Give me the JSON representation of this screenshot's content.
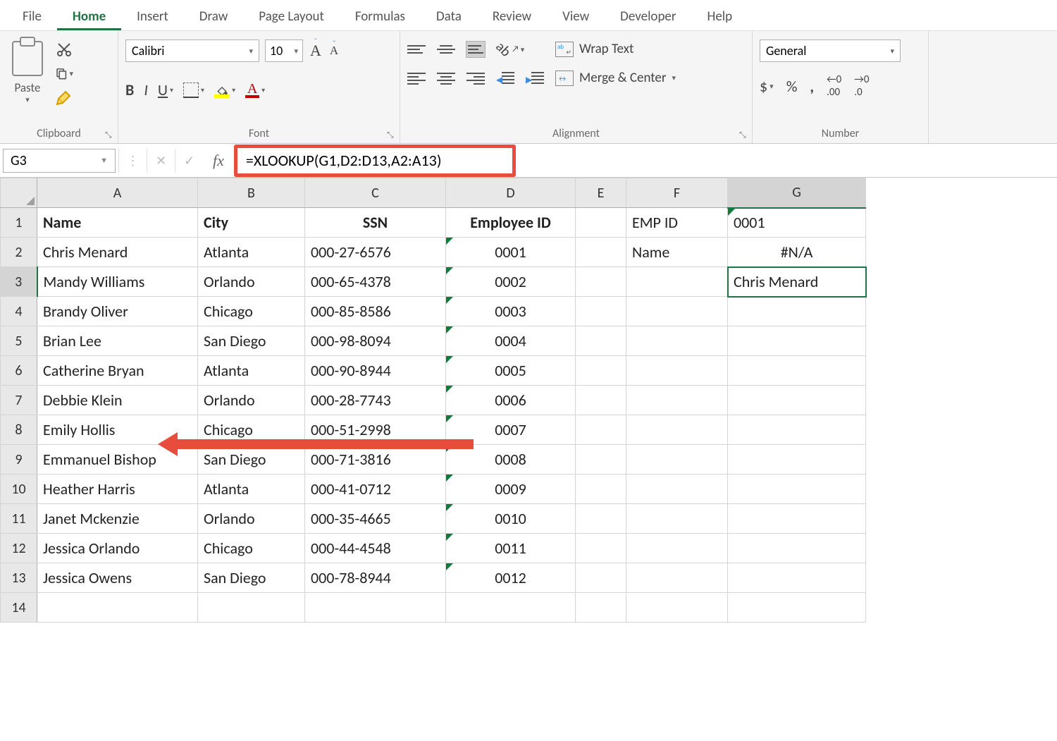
{
  "tabs": [
    "File",
    "Home",
    "Insert",
    "Draw",
    "Page Layout",
    "Formulas",
    "Data",
    "Review",
    "View",
    "Developer",
    "Help"
  ],
  "active_tab": "Home",
  "ribbon": {
    "clipboard": {
      "paste": "Paste",
      "label": "Clipboard"
    },
    "font": {
      "name": "Calibri",
      "size": "10",
      "label": "Font"
    },
    "alignment": {
      "wrap": "Wrap Text",
      "merge": "Merge & Center",
      "label": "Alignment"
    },
    "number": {
      "format": "General",
      "label": "Number"
    }
  },
  "formula_bar": {
    "name_box": "G3",
    "fx": "fx",
    "formula": "=XLOOKUP(G1,D2:D13,A2:A13)"
  },
  "columns": [
    "A",
    "B",
    "C",
    "D",
    "E",
    "F",
    "G"
  ],
  "row_numbers": [
    "1",
    "2",
    "3",
    "4",
    "5",
    "6",
    "7",
    "8",
    "9",
    "10",
    "11",
    "12",
    "13",
    "14"
  ],
  "headers": {
    "A": "Name",
    "B": "City",
    "C": "SSN",
    "D": "Employee ID"
  },
  "lookup": {
    "F1": "EMP ID",
    "G1": "0001",
    "F2": "Name",
    "G2": "#N/A",
    "G3": "Chris Menard"
  },
  "rows": [
    {
      "name": "Chris Menard",
      "city": "Atlanta",
      "ssn": "000-27-6576",
      "id": "0001"
    },
    {
      "name": "Mandy Williams",
      "city": "Orlando",
      "ssn": "000-65-4378",
      "id": "0002"
    },
    {
      "name": "Brandy Oliver",
      "city": "Chicago",
      "ssn": "000-85-8586",
      "id": "0003"
    },
    {
      "name": "Brian Lee",
      "city": "San Diego",
      "ssn": "000-98-8094",
      "id": "0004"
    },
    {
      "name": "Catherine Bryan",
      "city": "Atlanta",
      "ssn": "000-90-8944",
      "id": "0005"
    },
    {
      "name": "Debbie Klein",
      "city": "Orlando",
      "ssn": "000-28-7743",
      "id": "0006"
    },
    {
      "name": "Emily Hollis",
      "city": "Chicago",
      "ssn": "000-51-2998",
      "id": "0007"
    },
    {
      "name": "Emmanuel Bishop",
      "city": "San Diego",
      "ssn": "000-71-3816",
      "id": "0008"
    },
    {
      "name": "Heather Harris",
      "city": "Atlanta",
      "ssn": "000-41-0712",
      "id": "0009"
    },
    {
      "name": "Janet Mckenzie",
      "city": "Orlando",
      "ssn": "000-35-4665",
      "id": "0010"
    },
    {
      "name": "Jessica Orlando",
      "city": "Chicago",
      "ssn": "000-44-4548",
      "id": "0011"
    },
    {
      "name": "Jessica Owens",
      "city": "San Diego",
      "ssn": "000-78-8944",
      "id": "0012"
    }
  ]
}
